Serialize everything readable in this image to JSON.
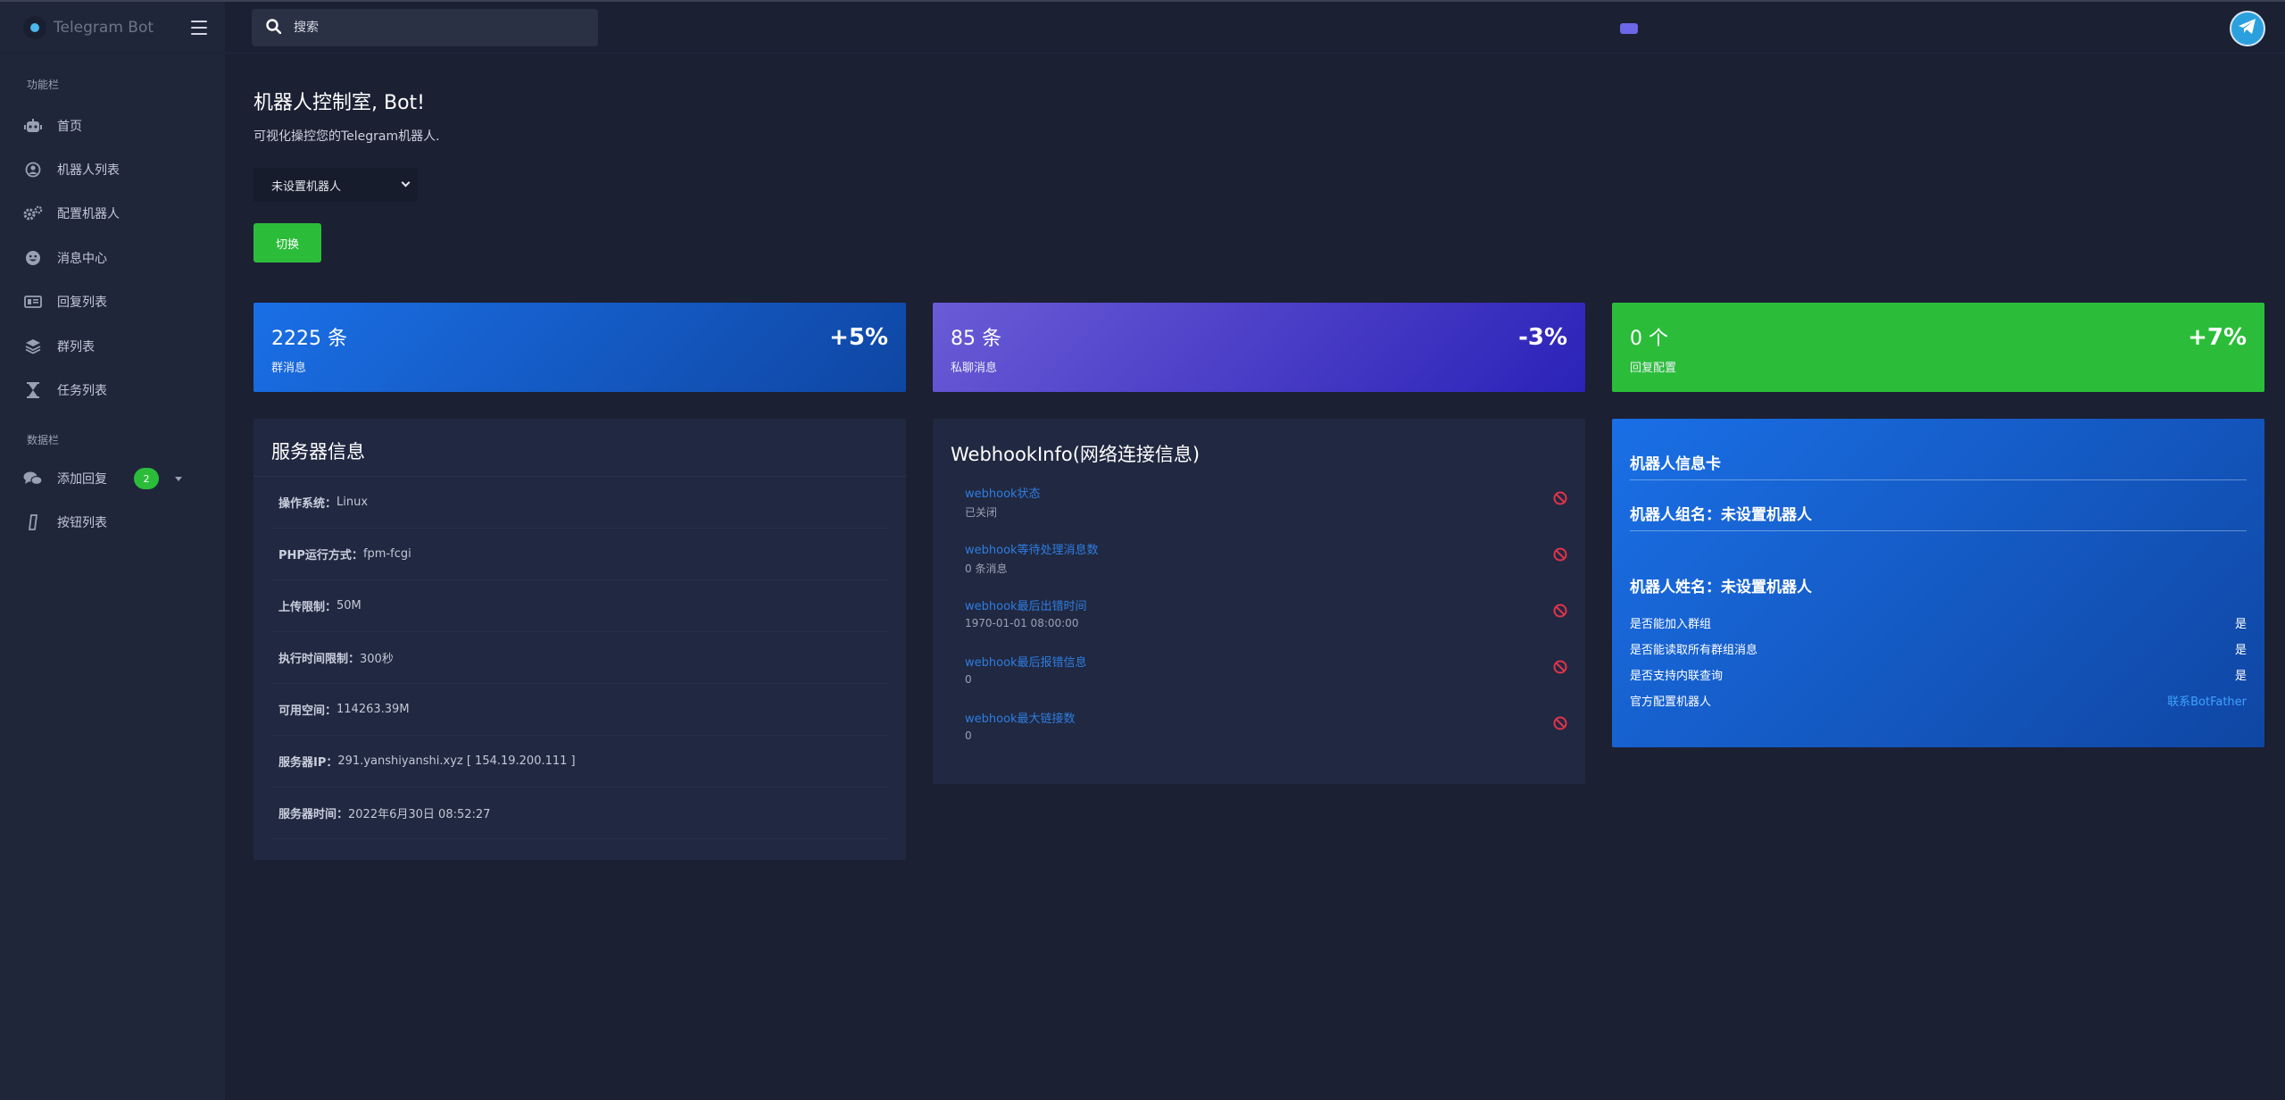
{
  "brand": {
    "name": "Telegram Bot"
  },
  "search": {
    "placeholder": "搜索"
  },
  "sidebar": {
    "section1": "功能栏",
    "section2": "数据栏",
    "items": [
      {
        "label": "首页",
        "icon": "robot-icon"
      },
      {
        "label": "机器人列表",
        "icon": "user-circle-icon"
      },
      {
        "label": "配置机器人",
        "icon": "gears-icon"
      },
      {
        "label": "消息中心",
        "icon": "smile-icon"
      },
      {
        "label": "回复列表",
        "icon": "id-card-icon"
      },
      {
        "label": "群列表",
        "icon": "layers-icon"
      },
      {
        "label": "任务列表",
        "icon": "hourglass-icon"
      }
    ],
    "data_items": [
      {
        "label": "添加回复",
        "icon": "comments-icon",
        "badge": "2"
      },
      {
        "label": "按钮列表",
        "icon": "pencil-icon"
      }
    ]
  },
  "main": {
    "title": "机器人控制室, Bot!",
    "subtitle": "可视化操控您的Telegram机器人.",
    "select_value": "未设置机器人",
    "switch_label": "切换"
  },
  "stats": [
    {
      "value": "2225 条",
      "label": "群消息",
      "change": "+5%"
    },
    {
      "value": "85 条",
      "label": "私聊消息",
      "change": "-3%"
    },
    {
      "value": "0 个",
      "label": "回复配置",
      "change": "+7%"
    }
  ],
  "server": {
    "title": "服务器信息",
    "rows": [
      {
        "key": "操作系统：",
        "value": "Linux"
      },
      {
        "key": "PHP运行方式：",
        "value": "fpm-fcgi"
      },
      {
        "key": "上传限制：",
        "value": "50M"
      },
      {
        "key": "执行时间限制：",
        "value": "300秒"
      },
      {
        "key": "可用空间：",
        "value": "114263.39M"
      },
      {
        "key": "服务器IP：",
        "value": "291.yanshiyanshi.xyz [ 154.19.200.111 ]"
      },
      {
        "key": "服务器时间：",
        "value": "2022年6月30日 08:52:27"
      }
    ]
  },
  "webhook": {
    "title": "WebhookInfo(网络连接信息)",
    "rows": [
      {
        "key": "webhook状态",
        "value": "已关闭"
      },
      {
        "key": "webhook等待处理消息数",
        "value": "0 条消息"
      },
      {
        "key": "webhook最后出错时间",
        "value": "1970-01-01 08:00:00"
      },
      {
        "key": "webhook最后报错信息",
        "value": "0"
      },
      {
        "key": "webhook最大链接数",
        "value": "0"
      }
    ]
  },
  "botcard": {
    "title": "机器人信息卡",
    "group_name": "机器人组名：未设置机器人",
    "bot_name": "机器人姓名：未设置机器人",
    "rows": [
      {
        "key": "是否能加入群组",
        "value": "是"
      },
      {
        "key": "是否能读取所有群组消息",
        "value": "是"
      },
      {
        "key": "是否支持内联查询",
        "value": "是"
      },
      {
        "key": "官方配置机器人",
        "value": "联系BotFather"
      }
    ]
  },
  "colors": {
    "background": "#1b2033",
    "sidebar": "#20263a",
    "accent_green": "#2bbd3a",
    "accent_blue": "#1a6fe6",
    "accent_purple": "#6a5bd6",
    "danger": "#e0344b"
  }
}
